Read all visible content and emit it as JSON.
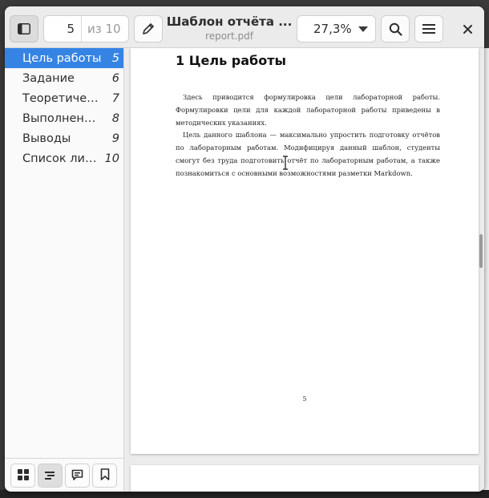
{
  "header": {
    "page_number": "5",
    "page_of": "из 10",
    "title": "Шаблон отчёта ...",
    "subtitle": "report.pdf",
    "zoom": "27,3%"
  },
  "icons": {
    "sidebar_toggle": "sidebar-toggle-icon",
    "annotate": "pencil-icon",
    "search": "search-icon",
    "menu": "hamburger-menu-icon",
    "close": "close-icon"
  },
  "sidebar": {
    "items": [
      {
        "label": "Цель работы",
        "page": "5"
      },
      {
        "label": "Задание",
        "page": "6"
      },
      {
        "label": "Теоретичес…",
        "page": "7"
      },
      {
        "label": "Выполнение…",
        "page": "8"
      },
      {
        "label": "Выводы",
        "page": "9"
      },
      {
        "label": "Список лите…",
        "page": "10"
      }
    ],
    "tabs": [
      "thumbnails-icon",
      "outline-icon",
      "annotations-icon",
      "bookmarks-icon"
    ]
  },
  "document": {
    "heading": "1  Цель работы",
    "paragraph1": "Здесь приводится формулировка цели лабораторной работы. Формулировки цели для каждой лабораторной работы приведены в методических указаниях.",
    "paragraph2": "Цель данного шаблона — максимально упростить подготовку отчётов по лабораторным работам. Модифицируя данный шаблон, студенты смогут без труда подготовить отчёт по лабораторным работам, а также познакомиться с основными возможностями разметки Markdown.",
    "page_number": "5"
  },
  "colors": {
    "accent": "#3584e4",
    "headerbar": "#ebebeb",
    "background": "#ececec"
  }
}
